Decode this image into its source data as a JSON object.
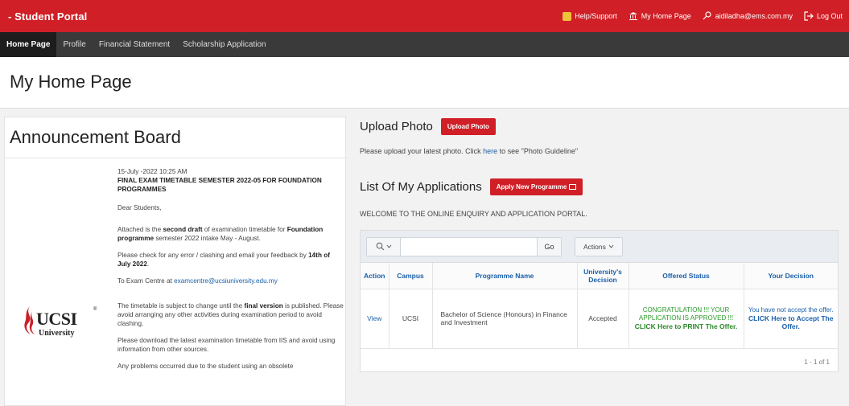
{
  "header": {
    "brand": "- Student Portal",
    "links": {
      "help": "Help/Support",
      "home": "My Home Page",
      "user": "aidiladha@ems.com.my",
      "logout": "Log Out"
    }
  },
  "nav": {
    "items": [
      {
        "label": "Home Page"
      },
      {
        "label": "Profile"
      },
      {
        "label": "Financial Statement"
      },
      {
        "label": "Scholarship Application"
      }
    ]
  },
  "page": {
    "title": "My Home Page"
  },
  "announcement": {
    "heading": "Announcement Board",
    "logo": {
      "word": "UCSI",
      "sub": "University",
      "reg": "®"
    },
    "date": "15-July -2022 10:25 AM",
    "title": "FINAL EXAM TIMETABLE SEMESTER 2022-05 FOR FOUNDATION PROGRAMMES",
    "greeting": "Dear Students,",
    "p1_a": "Attached is the ",
    "p1_b": "second draft",
    "p1_c": " of examination timetable for ",
    "p1_d": "Foundation programme",
    "p1_e": " semester 2022 intake May - August.",
    "p2_a": "Please check for any error / clashing and email your feedback by ",
    "p2_b": "14th of July 2022",
    "p2_c": ".",
    "p3_a": "To Exam Centre at ",
    "p3_b": "examcentre@ucsiuniversity.edu.my",
    "p4_a": "The timetable is subject to change until the ",
    "p4_b": "final version",
    "p4_c": " is published. Please avoid arranging any other activities during examination period to avoid clashing.",
    "p5": "Please download the latest examination timetable from IIS and avoid using information from other sources.",
    "p6": "Any problems occurred due to the student using an obsolete"
  },
  "upload": {
    "heading": "Upload Photo",
    "button": "Upload Photo",
    "note_a": "Please upload your latest photo. Click ",
    "note_link": "here",
    "note_b": " to see \"Photo Guideline\""
  },
  "applications": {
    "heading": "List Of My Applications",
    "button": "Apply New Programme",
    "welcome": "WELCOME TO THE ONLINE ENQUIRY AND APPLICATION PORTAL.",
    "search": {
      "value": "",
      "placeholder": "",
      "go": "Go",
      "actions": "Actions"
    },
    "columns": [
      "Action",
      "Campus",
      "Programme Name",
      "University's Decision",
      "Offered Status",
      "Your Decision"
    ],
    "rows": [
      {
        "action": "View",
        "campus": "UCSI",
        "programme": "Bachelor of Science (Honours) in Finance and Investment",
        "decision": "Accepted",
        "offered_msg": "CONGRATULATION !!! YOUR APPLICATION IS APPROVED !!!",
        "offered_link": "CLICK Here to PRINT The Offer.",
        "your_msg": "You have not accept the offer.",
        "your_link": "CLICK Here to Accept The Offer."
      }
    ],
    "pagination": "1 - 1 of 1"
  },
  "colors": {
    "primary_red": "#d01f26",
    "nav_dark": "#3a3a3a",
    "link_blue": "#1a5fa8",
    "success_green": "#2b9a2b"
  }
}
